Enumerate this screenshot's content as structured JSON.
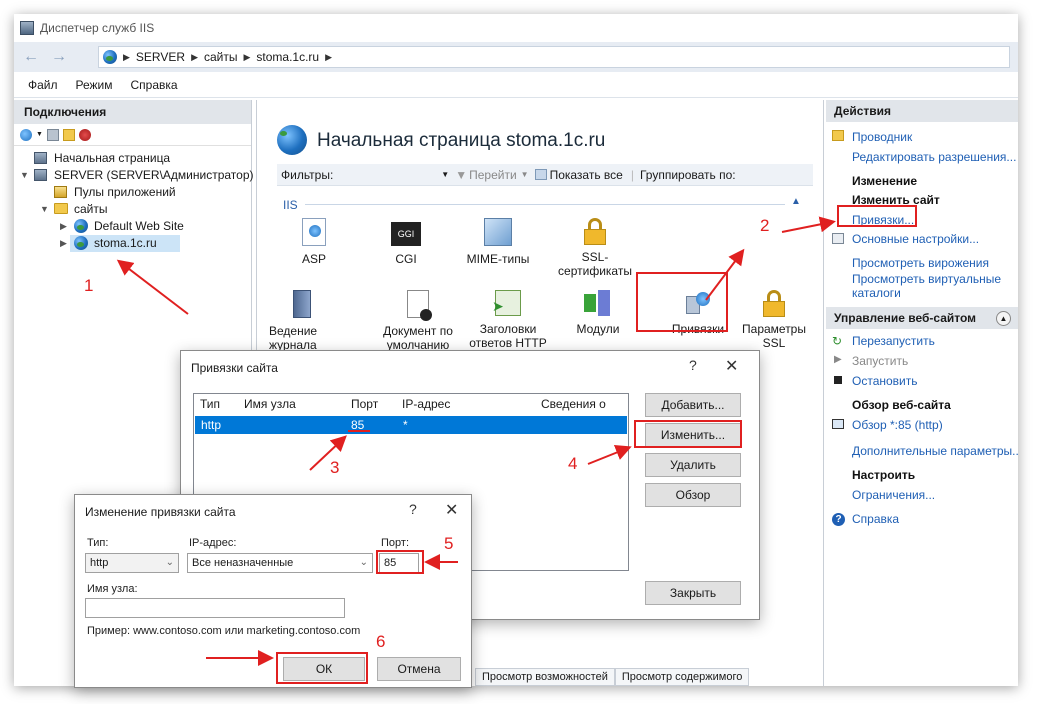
{
  "window": {
    "title": "Диспетчер служб IIS"
  },
  "address": {
    "crumbs": [
      "SERVER",
      "сайты",
      "stoma.1c.ru"
    ]
  },
  "menu": [
    "Файл",
    "Режим",
    "Справка"
  ],
  "connections": {
    "header": "Подключения",
    "tree": [
      {
        "label": "Начальная страница"
      },
      {
        "label": "SERVER (SERVER\\Администратор)"
      },
      {
        "label": "Пулы приложений"
      },
      {
        "label": "сайты"
      },
      {
        "label": "Default Web Site"
      },
      {
        "label": "stoma.1c.ru"
      }
    ]
  },
  "main": {
    "title": "Начальная страница stoma.1c.ru",
    "filters": {
      "label": "Фильтры:",
      "go": "Перейти",
      "show_all": "Показать все",
      "group": "Группировать по:"
    },
    "section": "IIS",
    "features": [
      "ASP",
      "CGI",
      "MIME-типы",
      "SSL-сертификаты",
      "Ведение журнала",
      "Документ по умолчанию",
      "Заголовки ответов HTTP",
      "Модули",
      "Привязки",
      "Параметры SSL"
    ],
    "tabs": [
      "Просмотр возможностей",
      "Просмотр содержимого"
    ]
  },
  "actions": {
    "header": "Действия",
    "explorer": "Проводник",
    "edit_perms": "Редактировать разрешения...",
    "change_head": "Изменение",
    "edit_site": "Изменить сайт",
    "bindings": "Привязки...",
    "basic_settings": "Основные настройки...",
    "view_apps": "Просмотреть вирожения",
    "view_vdirs": "Просмотреть виртуальные каталоги",
    "manage_head": "Управление веб-сайтом",
    "restart": "Перезапустить",
    "start": "Запустить",
    "stop": "Остановить",
    "browse_head": "Обзор веб-сайта",
    "browse": "Обзор *:85 (http)",
    "advanced": "Дополнительные параметры...",
    "configure_head": "Настроить",
    "limits": "Ограничения...",
    "help": "Справка"
  },
  "bindings_dialog": {
    "title": "Привязки сайта",
    "columns": [
      "Тип",
      "Имя узла",
      "Порт",
      "IP-адрес",
      "Сведения о пр..."
    ],
    "rows": [
      {
        "type": "http",
        "host": "",
        "port": "85",
        "ip": "*",
        "info": ""
      }
    ],
    "buttons": {
      "add": "Добавить...",
      "edit": "Изменить...",
      "remove": "Удалить",
      "browse": "Обзор",
      "close": "Закрыть"
    }
  },
  "edit_dialog": {
    "title": "Изменение привязки сайта",
    "type_label": "Тип:",
    "type_value": "http",
    "ip_label": "IP-адрес:",
    "ip_value": "Все неназначенные",
    "port_label": "Порт:",
    "port_value": "85",
    "host_label": "Имя узла:",
    "host_value": "",
    "example": "Пример: www.contoso.com или marketing.contoso.com",
    "ok": "ОК",
    "cancel": "Отмена"
  },
  "annotations": [
    "1",
    "2",
    "3",
    "4",
    "5",
    "6"
  ],
  "colors": {
    "annotation": "#e02020",
    "selection": "#0078d7",
    "link": "#1f5fb4"
  }
}
